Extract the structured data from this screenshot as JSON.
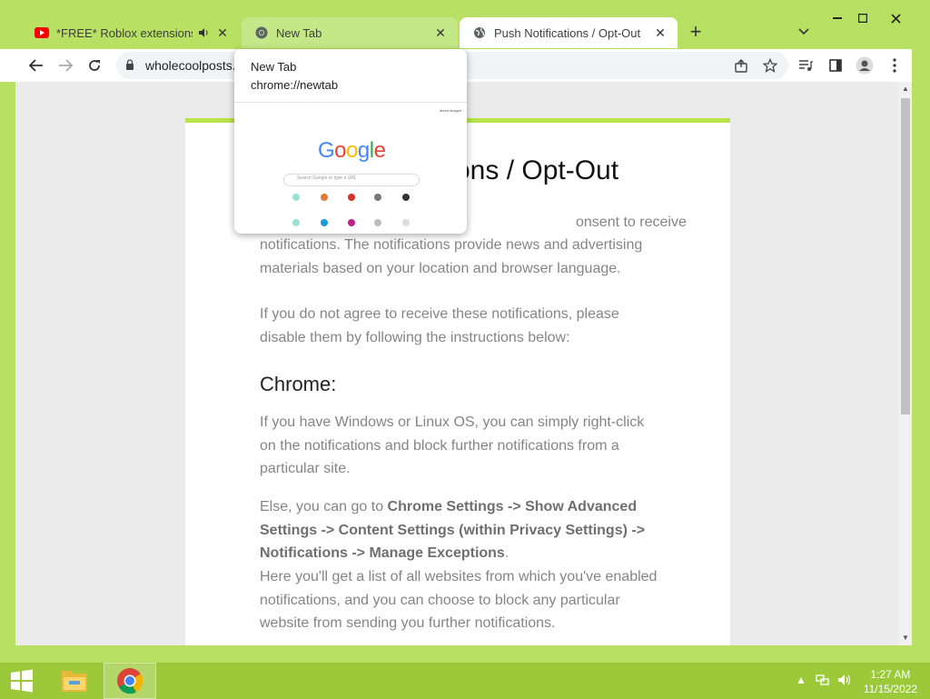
{
  "tabs": [
    {
      "label": "*FREE* Roblox extensions *Y",
      "icon": "youtube-icon",
      "audio": true,
      "state": "inactive"
    },
    {
      "label": "New Tab",
      "icon": "chrome-icon",
      "state": "hovered"
    },
    {
      "label": "Push Notifications / Opt-Out",
      "icon": "globe-icon",
      "state": "active"
    }
  ],
  "close_glyph": "✕",
  "toolbar": {
    "url": "wholecoolposts."
  },
  "hover_card": {
    "title": "New Tab",
    "url": "chrome://newtab",
    "thumb_links": "about  images",
    "thumb_search_placeholder": "Search Google or type a URL",
    "thumb_logo": "Google"
  },
  "page": {
    "title": "ons / Opt-Out",
    "p1_line1": "onsent to receive",
    "p1_rest": "notifications. The notifications provide news and advertising materials based on your location and browser language.",
    "p2": "If you do not agree to receive these notifications, please disable them by following the instructions below:",
    "h_chrome": "Chrome:",
    "p3": "If you have Windows or Linux OS, you can simply right-click on the notifications and block further notifications from a particular site.",
    "p4_pre": "Else, you can go to ",
    "p4_bold": "Chrome Settings -> Show Advanced Settings -> Content Settings (within Privacy Settings) -> Notifications -> Manage Exceptions",
    "p4_post": ".",
    "p5": "Here you'll get a list of all websites from which you've enabled notifications, and you can choose to block any particular website from sending you further notifications."
  },
  "taskbar": {
    "time": "1:27 AM",
    "date": "11/15/2022"
  },
  "colors": {
    "accent_bar": "#b6e34a",
    "tabstrip": "#b8e062",
    "taskbar": "#9bc93a"
  }
}
